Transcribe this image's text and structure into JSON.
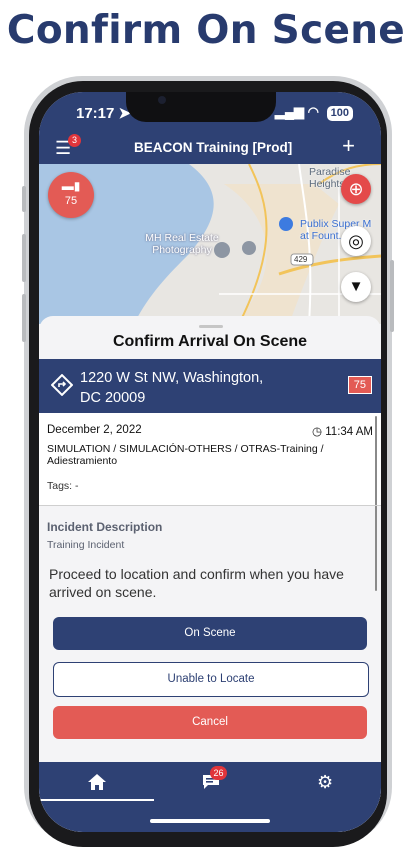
{
  "headline": "Confirm On Scene",
  "status_bar": {
    "time": "17:17",
    "battery": "100"
  },
  "app_bar": {
    "title": "BEACON Training [Prod]",
    "menu_badge": "3"
  },
  "map": {
    "unit_number": "75",
    "labels": {
      "paradise_heights": "Paradise Heights",
      "real_estate": "MH Real Estate Photography",
      "publix": "Publix Super M at Fount... W",
      "route": "429"
    }
  },
  "sheet": {
    "title": "Confirm Arrival On Scene",
    "address_line1": "1220 W St NW, Washington,",
    "address_line2": "DC 20009",
    "unit_badge": "75",
    "date": "December 2, 2022",
    "time": "11:34 AM",
    "incident_types": "SIMULATION / SIMULACIÓN-OTHERS / OTRAS-Training / Adiestramiento",
    "tags": "Tags: -",
    "description_heading": "Incident Description",
    "description": "Training Incident",
    "instruction": "Proceed to location and confirm when you have arrived on scene."
  },
  "buttons": {
    "on_scene": "On Scene",
    "unable": "Unable to Locate",
    "cancel": "Cancel"
  },
  "nav": {
    "chat_badge": "26"
  },
  "colors": {
    "primary": "#2e4174",
    "danger": "#e35b55",
    "headline": "#283b6e"
  }
}
